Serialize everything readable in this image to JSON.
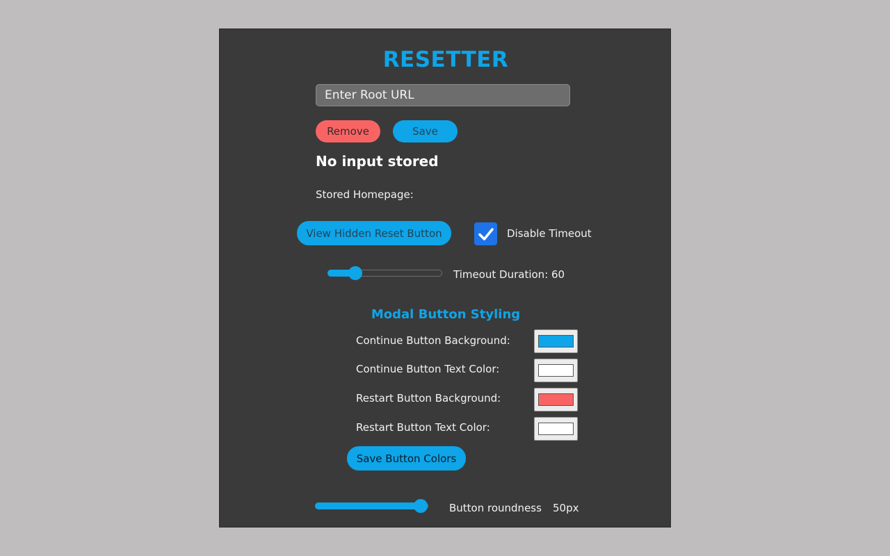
{
  "app": {
    "title": "RESETTER"
  },
  "url_input": {
    "placeholder": "Enter Root URL",
    "value": ""
  },
  "buttons": {
    "remove_label": "Remove",
    "save_label": "Save",
    "view_hidden_label": "View Hidden Reset Button",
    "save_colors_label": "Save Button Colors"
  },
  "status": {
    "message": "No input stored",
    "stored_homepage_label": "Stored Homepage:"
  },
  "timeout": {
    "disable_label": "Disable Timeout",
    "disabled_checked": true,
    "duration_label": "Timeout Duration: 60",
    "duration_value": 60,
    "duration_fraction": 0.2
  },
  "modal_styling": {
    "heading": "Modal Button Styling",
    "rows": [
      {
        "label": "Continue Button Background:",
        "color": "#0ea5e9"
      },
      {
        "label": "Continue Button Text Color:",
        "color": "#ffffff"
      },
      {
        "label": "Restart Button Background:",
        "color": "#f86464"
      },
      {
        "label": "Restart Button Text Color:",
        "color": "#ffffff"
      }
    ]
  },
  "roundness": {
    "label": "Button roundness",
    "value_text": "50px",
    "value": 50,
    "fraction": 1.0
  },
  "colors": {
    "accent": "#0ea5e9",
    "danger": "#f86464",
    "panel": "#3a3a3a",
    "page": "#bfbdbd",
    "checkbox": "#1e73e8"
  }
}
